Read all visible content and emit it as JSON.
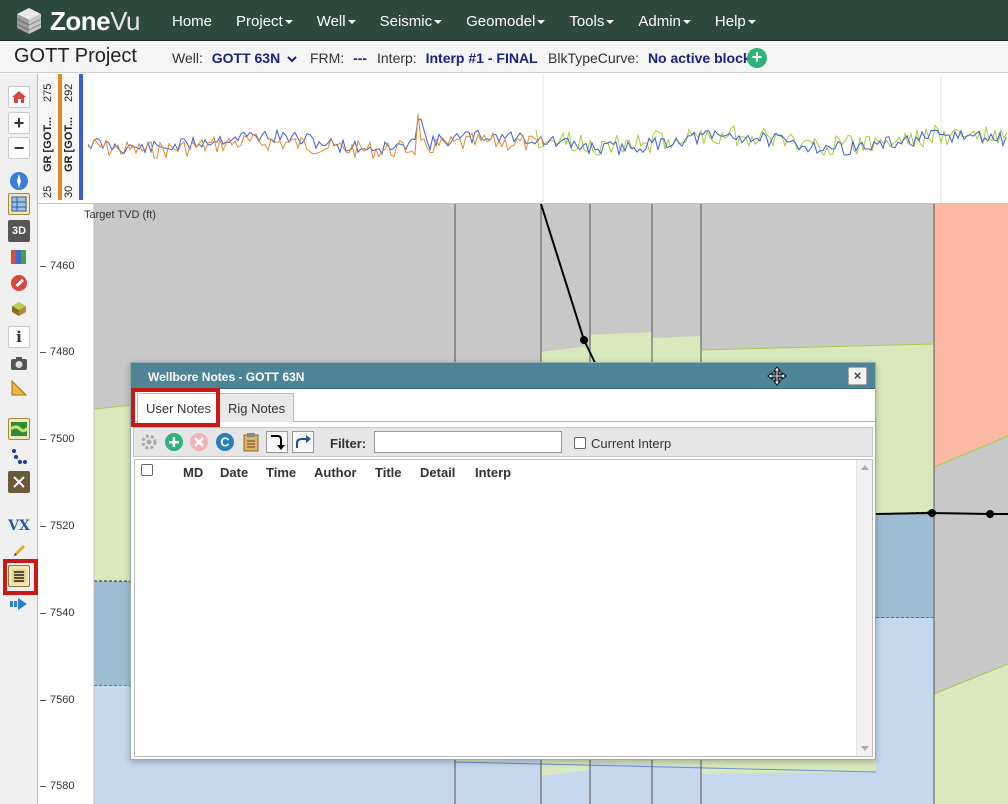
{
  "app": {
    "brand_prefix": "Zone",
    "brand_suffix": "Vu"
  },
  "nav": {
    "items": [
      {
        "label": "Home",
        "dropdown": false
      },
      {
        "label": "Project",
        "dropdown": true
      },
      {
        "label": "Well",
        "dropdown": true
      },
      {
        "label": "Seismic",
        "dropdown": true
      },
      {
        "label": "Geomodel",
        "dropdown": true
      },
      {
        "label": "Tools",
        "dropdown": true
      },
      {
        "label": "Admin",
        "dropdown": true
      },
      {
        "label": "Help",
        "dropdown": true
      }
    ]
  },
  "project": {
    "title": "GOTT Project",
    "well_label": "Well:",
    "well_value": "GOTT 63N",
    "frm_label": "FRM:",
    "frm_value": "---",
    "interp_label": "Interp:",
    "interp_value": "Interp #1 - FINAL",
    "blk_label": "BlkTypeCurve:",
    "blk_value": "No active block"
  },
  "log_track": {
    "curve1_label": "GR [GOT...",
    "curve2_label": "GR [GOT...",
    "scale1_min": "25",
    "scale1_max": "275",
    "scale2_min": "30",
    "scale2_max": "292",
    "colors": {
      "curve1": "#e08a2c",
      "curve2": "#3b5fd6",
      "curve3": "#a8cc3c"
    }
  },
  "cross_section": {
    "axis_title": "Target TVD (ft)",
    "ticks": [
      "7460",
      "7480",
      "7500",
      "7520",
      "7540",
      "7560",
      "7580"
    ]
  },
  "dialog": {
    "title": "Wellbore Notes - GOTT 63N",
    "close_label": "×",
    "tabs": [
      {
        "label": "User Notes",
        "active": true
      },
      {
        "label": "Rig Notes",
        "active": false
      }
    ],
    "toolbar_icons": [
      "settings-icon",
      "add-icon",
      "delete-icon",
      "copy-icon",
      "clipboard-icon",
      "import-icon",
      "export-icon"
    ],
    "filter_label": "Filter:",
    "filter_value": "",
    "current_interp_label": "Current Interp",
    "current_interp_checked": false,
    "columns": [
      "MD",
      "Date",
      "Time",
      "Author",
      "Title",
      "Detail",
      "Interp"
    ]
  }
}
